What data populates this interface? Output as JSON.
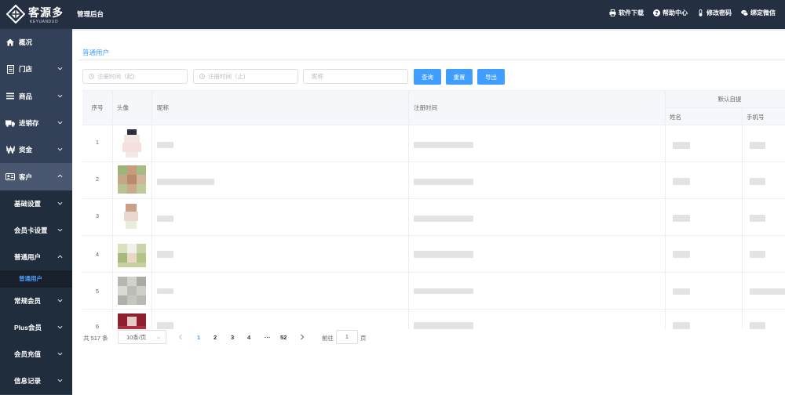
{
  "brand": {
    "name": "客源多",
    "subtitle": "KEYUANDUO"
  },
  "header": {
    "title": "管理后台",
    "actions": [
      {
        "label": "软件下载",
        "icon": "printer-icon"
      },
      {
        "label": "帮助中心",
        "icon": "help-icon"
      },
      {
        "label": "修改密码",
        "icon": "thermometer-icon"
      },
      {
        "label": "绑定微信",
        "icon": "wechat-icon"
      }
    ]
  },
  "sidebar": {
    "items": [
      {
        "label": "概况",
        "icon": "home-icon"
      },
      {
        "label": "门店",
        "icon": "document-icon"
      },
      {
        "label": "商品",
        "icon": "list-icon"
      },
      {
        "label": "进销存",
        "icon": "truck-icon"
      },
      {
        "label": "资金",
        "icon": "won-icon"
      },
      {
        "label": "客户",
        "icon": "id-card-icon"
      }
    ],
    "sub_items": [
      {
        "label": "基础设置"
      },
      {
        "label": "会员卡设置"
      },
      {
        "label": "普通用户"
      }
    ],
    "active_leaf": "普通用户",
    "lower_items": [
      {
        "label": "常规会员"
      },
      {
        "label": "Plus会员"
      },
      {
        "label": "会员充值"
      },
      {
        "label": "信息记录"
      }
    ]
  },
  "page": {
    "title": "普通用户",
    "filters": {
      "start_placeholder": "注册时间（起)",
      "end_placeholder": "注册时间（止)",
      "nickname_placeholder": "昵称"
    },
    "buttons": {
      "search": "查询",
      "reset": "重置",
      "export": "导出"
    }
  },
  "table": {
    "headers": {
      "index": "序号",
      "avatar": "头像",
      "nickname": "昵称",
      "register_time": "注册时间",
      "default_pickup": "默认自提",
      "name": "姓名",
      "phone": "手机号"
    },
    "rows": [
      {
        "index": "1"
      },
      {
        "index": "2"
      },
      {
        "index": "3"
      },
      {
        "index": "4"
      },
      {
        "index": "5"
      },
      {
        "index": "6"
      }
    ]
  },
  "pagination": {
    "total": "共 517 条",
    "page_size": "10条/页",
    "pages": [
      "1",
      "2",
      "3",
      "4",
      "···",
      "52"
    ],
    "current_page": "1",
    "goto_label": "前往",
    "goto_value": "1",
    "page_suffix": "页"
  },
  "colors": {
    "topbar": "#242f42",
    "sidebar": "#324157",
    "accent": "#409eff"
  }
}
